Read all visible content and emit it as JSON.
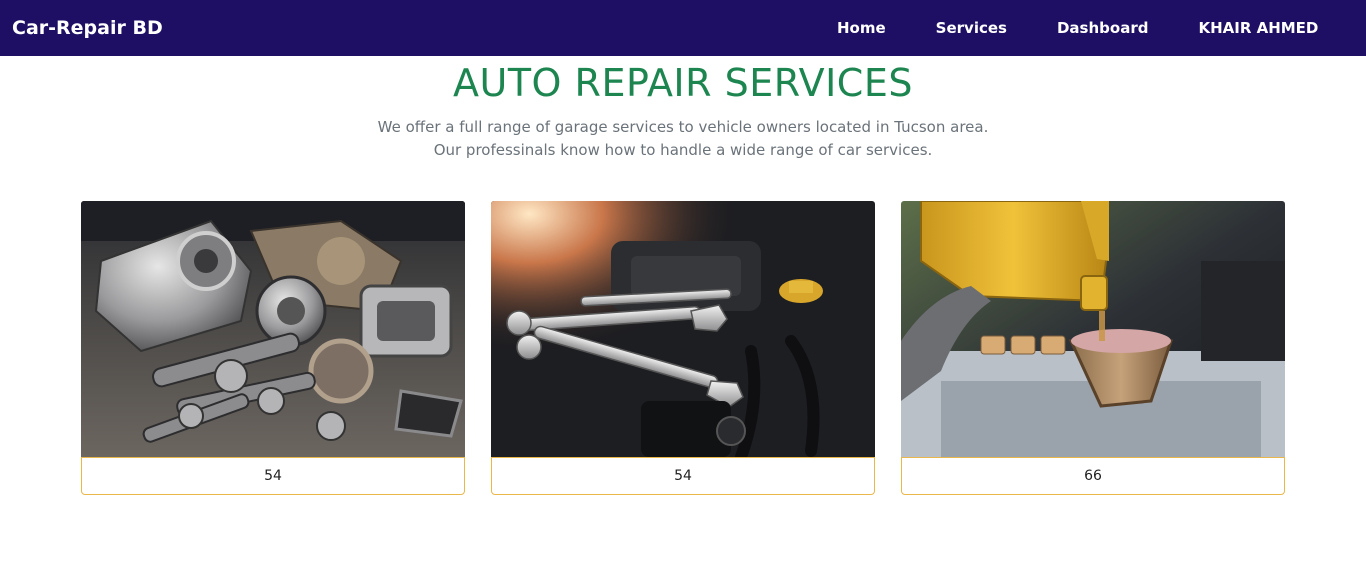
{
  "navbar": {
    "brand": "Car-Repair BD",
    "links": [
      {
        "label": "Home"
      },
      {
        "label": "Services"
      },
      {
        "label": "Dashboard"
      },
      {
        "label": "KHAIR AHMED"
      }
    ]
  },
  "hero": {
    "title": "AUTO REPAIR SERVICES",
    "subtitle_line1": "We offer a full range of garage services to vehicle owners located in Tucson area.",
    "subtitle_line2": "Our professinals know how to handle a wide range of car services."
  },
  "services": [
    {
      "image": "car-parts-photo",
      "value": "54"
    },
    {
      "image": "engine-wrenches-photo",
      "value": "54"
    },
    {
      "image": "oil-change-photo",
      "value": "66"
    }
  ],
  "colors": {
    "navbar_bg": "#1e0f65",
    "title_green": "#1d8650",
    "card_border": "#eab84a"
  }
}
